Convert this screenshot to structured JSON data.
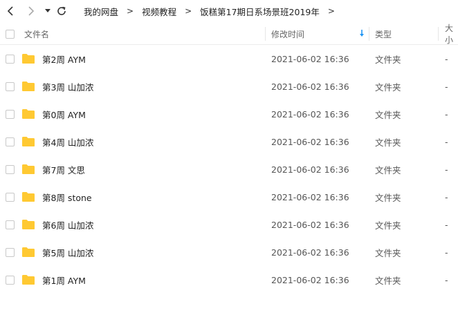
{
  "breadcrumb": [
    "我的网盘",
    "视频教程",
    "饭糕第17期日系场景班2019年"
  ],
  "breadcrumb_sep": ">",
  "header": {
    "name": "文件名",
    "modified": "修改时间",
    "type": "类型",
    "size": "大小"
  },
  "icons": {
    "back": "chevron-left-icon",
    "forward": "chevron-right-icon",
    "dropdown": "caret-down-icon",
    "refresh": "refresh-icon",
    "folder": "folder-icon",
    "sort": "sort-down-arrow-icon"
  },
  "colors": {
    "folder": "#FFC933",
    "sort_arrow": "#2196F3"
  },
  "rows": [
    {
      "name": "第2周 AYM",
      "modified": "2021-06-02 16:36",
      "type": "文件夹",
      "size": "-"
    },
    {
      "name": "第3周 山加浓",
      "modified": "2021-06-02 16:36",
      "type": "文件夹",
      "size": "-"
    },
    {
      "name": "第0周 AYM",
      "modified": "2021-06-02 16:36",
      "type": "文件夹",
      "size": "-"
    },
    {
      "name": "第4周 山加浓",
      "modified": "2021-06-02 16:36",
      "type": "文件夹",
      "size": "-"
    },
    {
      "name": "第7周 文思",
      "modified": "2021-06-02 16:36",
      "type": "文件夹",
      "size": "-"
    },
    {
      "name": "第8周 stone",
      "modified": "2021-06-02 16:36",
      "type": "文件夹",
      "size": "-"
    },
    {
      "name": "第6周 山加浓",
      "modified": "2021-06-02 16:36",
      "type": "文件夹",
      "size": "-"
    },
    {
      "name": "第5周 山加浓",
      "modified": "2021-06-02 16:36",
      "type": "文件夹",
      "size": "-"
    },
    {
      "name": "第1周 AYM",
      "modified": "2021-06-02 16:36",
      "type": "文件夹",
      "size": "-"
    }
  ]
}
